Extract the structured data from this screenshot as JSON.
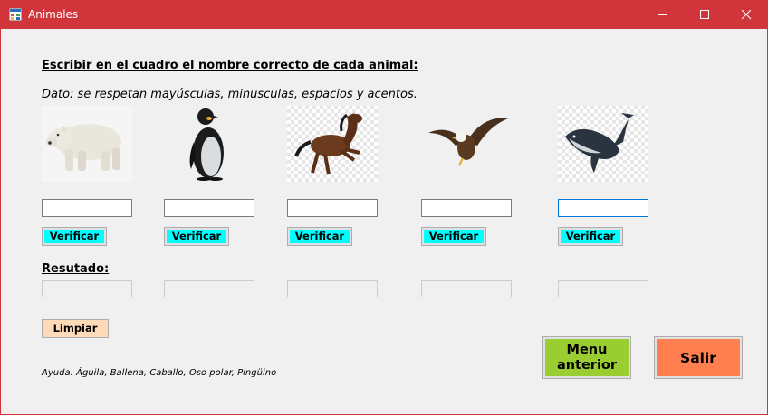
{
  "window": {
    "title": "Animales",
    "accent_color": "#d1343a",
    "controls": [
      "minimize-icon",
      "maximize-icon",
      "close-icon"
    ]
  },
  "instruction": "Escribir en el cuadro el nombre correcto de cada animal:",
  "hint": "Dato: se respetan mayúsculas, minusculas, espacios y acentos.",
  "animals": [
    {
      "image": "polar-bear",
      "answer_value": "",
      "verify_label": "Verificar",
      "result_value": ""
    },
    {
      "image": "penguin",
      "answer_value": "",
      "verify_label": "Verificar",
      "result_value": ""
    },
    {
      "image": "horse",
      "answer_value": "",
      "verify_label": "Verificar",
      "result_value": ""
    },
    {
      "image": "eagle",
      "answer_value": "",
      "verify_label": "Verificar",
      "result_value": ""
    },
    {
      "image": "whale",
      "answer_value": "",
      "verify_label": "Verificar",
      "result_value": ""
    }
  ],
  "result_label": "Resutado:",
  "clear_label": "Limpiar",
  "menu_label_line1": "Menu",
  "menu_label_line2": "anterior",
  "exit_label": "Salir",
  "help_text": "Ayuda: Águila, Ballena, Caballo, Oso polar, Pingüino",
  "colors": {
    "verify": "#00ffff",
    "clear": "#ffdab9",
    "menu": "#9acd32",
    "exit": "#ff7f50"
  }
}
